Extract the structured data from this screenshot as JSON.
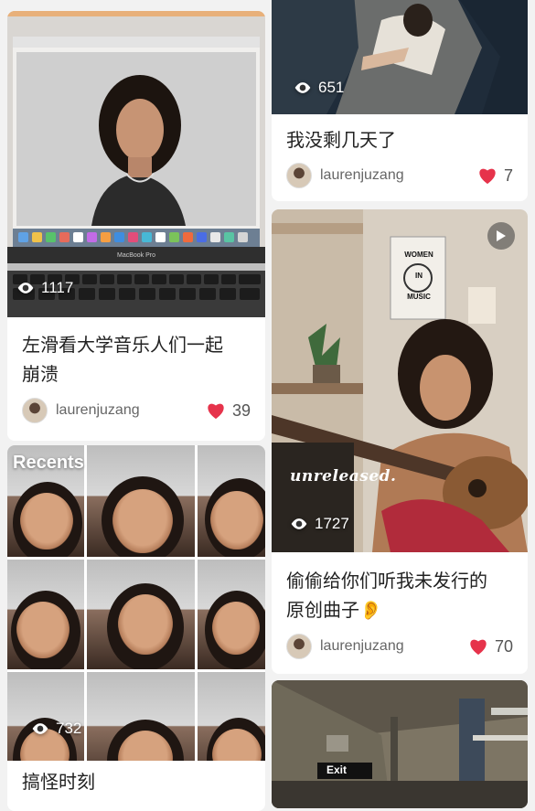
{
  "cards": [
    {
      "id": "left-top",
      "views": "1117",
      "title_lines": [
        "左滑看大学音乐人们一起",
        "崩溃"
      ],
      "username": "laurenjuzang",
      "likes": "39",
      "screen_text": "MacBook Pro"
    },
    {
      "id": "right-top",
      "views": "651",
      "title_lines": [
        "我没剩几天了"
      ],
      "username": "laurenjuzang",
      "likes": "7"
    },
    {
      "id": "right-middle",
      "views": "1727",
      "title_lines": [
        "偷偷给你们听我未发行的",
        "原创曲子👂"
      ],
      "username": "laurenjuzang",
      "likes": "70",
      "overlay_text": "unreleased.",
      "poster_text": [
        "WOMEN",
        "IN",
        "MUSIC"
      ]
    },
    {
      "id": "left-bottom",
      "views": "732",
      "title_lines": [
        "搞怪时刻"
      ],
      "overlay_text": "Recents"
    },
    {
      "id": "right-bottom",
      "sign_text": "Exit"
    }
  ],
  "colors": {
    "heart": "#e6334b",
    "background": "#f2f2f2"
  },
  "icons": {
    "views": "eye-icon",
    "likes": "heart-icon",
    "video": "play-icon"
  }
}
